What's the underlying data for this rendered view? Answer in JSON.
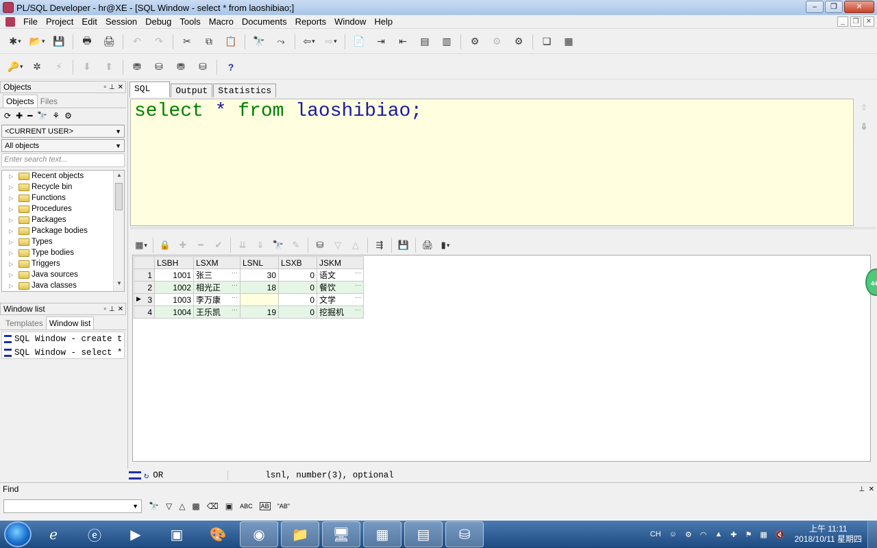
{
  "window": {
    "title": "PL/SQL Developer - hr@XE - [SQL Window - select * from laoshibiao;]"
  },
  "menu": [
    "File",
    "Project",
    "Edit",
    "Session",
    "Debug",
    "Tools",
    "Macro",
    "Documents",
    "Reports",
    "Window",
    "Help"
  ],
  "left": {
    "objects_title": "Objects",
    "subtabs": [
      "Objects",
      "Files"
    ],
    "user_combo": "<CURRENT USER>",
    "filter_combo": "All objects",
    "search_placeholder": "Enter search text...",
    "tree": [
      "Recent objects",
      "Recycle bin",
      "Functions",
      "Procedures",
      "Packages",
      "Package bodies",
      "Types",
      "Type bodies",
      "Triggers",
      "Java sources",
      "Java classes"
    ],
    "windowlist_title": "Window list",
    "wl_tabs": [
      "Templates",
      "Window list"
    ],
    "windows": [
      "SQL Window - create t",
      "SQL Window - select *"
    ]
  },
  "editor": {
    "tabs": [
      "SQL",
      "Output",
      "Statistics"
    ],
    "sql": {
      "kw1": "select",
      "star": "*",
      "kw2": "from",
      "table": "laoshibiao",
      "semi": ";"
    }
  },
  "results": {
    "columns": [
      "LSBH",
      "LSXM",
      "LSNL",
      "LSXB",
      "JSKM"
    ],
    "rows": [
      {
        "n": "1",
        "lsbh": "1001",
        "lsxm": "张三",
        "lsnl": "30",
        "lsxb": "0",
        "jskm": "语文"
      },
      {
        "n": "2",
        "lsbh": "1002",
        "lsxm": "相光正",
        "lsnl": "18",
        "lsxb": "0",
        "jskm": "餐饮"
      },
      {
        "n": "3",
        "lsbh": "1003",
        "lsxm": "李万康",
        "lsnl": "",
        "lsxb": "0",
        "jskm": "文学"
      },
      {
        "n": "4",
        "lsbh": "1004",
        "lsxm": "王乐凯",
        "lsnl": "19",
        "lsxb": "0",
        "jskm": "挖掘机"
      }
    ],
    "bubble": "44"
  },
  "status": {
    "mode": "OR",
    "info": "lsnl, number(3), optional"
  },
  "find": {
    "title": "Find",
    "opt_abc": "ABC",
    "opt_ab": "AB",
    "opt_quoted": "\"AB\""
  },
  "taskbar": {
    "ime": "CH",
    "time": "上午 11:11",
    "date": "2018/10/11 星期四"
  }
}
